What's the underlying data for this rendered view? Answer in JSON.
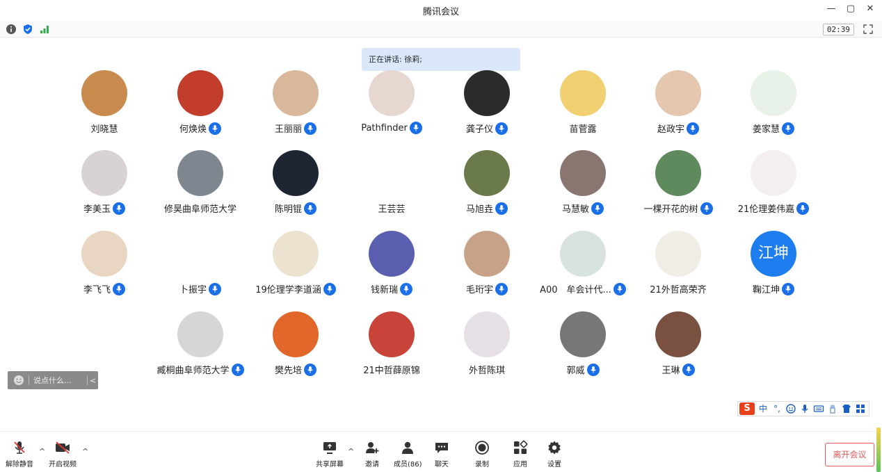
{
  "window": {
    "title": "腾讯会议",
    "minimize": "—",
    "restore": "▢",
    "close": "✕"
  },
  "meeting": {
    "timer": "02:39",
    "speaking": "正在讲话: 徐莉;"
  },
  "participants": [
    {
      "name": "刘晓慧",
      "mic": false,
      "bg": "#c98a4d"
    },
    {
      "name": "何焕焕",
      "mic": true,
      "bg": "#c23d2c"
    },
    {
      "name": "王丽丽",
      "mic": true,
      "bg": "#d9b79a"
    },
    {
      "name": "Pathfinder",
      "mic": true,
      "bg": "#e6d7d0"
    },
    {
      "name": "龚子仪",
      "mic": true,
      "bg": "#2b2b2b"
    },
    {
      "name": "苗菅露",
      "mic": false,
      "bg": "#f0d070"
    },
    {
      "name": "赵政宇",
      "mic": true,
      "bg": "#e5c7b0"
    },
    {
      "name": "姜家慧",
      "mic": true,
      "bg": "#e8f2e8"
    },
    {
      "name": "李美玉",
      "mic": true,
      "bg": "#d8d2d2"
    },
    {
      "name": "修昊曲阜师范大学",
      "mic": false,
      "bg": "#7e8790"
    },
    {
      "name": "陈明锟",
      "mic": true,
      "bg": "#1e2634"
    },
    {
      "name": "王芸芸",
      "mic": false,
      "bg": "#ffffff"
    },
    {
      "name": "马旭垚",
      "mic": true,
      "bg": "#6a7a4a"
    },
    {
      "name": "马慧敏",
      "mic": true,
      "bg": "#8a7670"
    },
    {
      "name": "一棵开花的树",
      "mic": true,
      "bg": "#5e8a5e"
    },
    {
      "name": "21伦理姜伟嘉",
      "mic": true,
      "bg": "#f2efee"
    },
    {
      "name": "李飞飞",
      "mic": true,
      "bg": "#e8d6c2"
    },
    {
      "name": "卜振宇",
      "mic": true,
      "bg": "#ffffff"
    },
    {
      "name": "19伦理学李道涵",
      "mic": true,
      "bg": "#ece2d0"
    },
    {
      "name": "钱新瑞",
      "mic": true,
      "bg": "#5a5fb0"
    },
    {
      "name": "毛珩宇",
      "mic": true,
      "bg": "#c8a288"
    },
    {
      "name": "A00　牟会计代...",
      "mic": true,
      "bg": "#d8e2de"
    },
    {
      "name": "21外哲高荣齐",
      "mic": false,
      "bg": "#f1ece4"
    },
    {
      "name": "鞠江坤",
      "mic": true,
      "text": "江坤",
      "bg": "#1e7ef0"
    },
    {
      "name": "臧桐曲阜师范大学",
      "mic": true,
      "bg": "#d6d6d6"
    },
    {
      "name": "樊先培",
      "mic": true,
      "bg": "#e0662a"
    },
    {
      "name": "21中哲薛原锦",
      "mic": false,
      "bg": "#c8443a"
    },
    {
      "name": "外哲陈琪",
      "mic": false,
      "bg": "#e6e0e6"
    },
    {
      "name": "郭威",
      "mic": true,
      "bg": "#777777"
    },
    {
      "name": "王琳",
      "mic": true,
      "bg": "#7a5040"
    }
  ],
  "chat": {
    "placeholder": "说点什么...",
    "arrow": "<"
  },
  "ime": {
    "logo": "S",
    "lang": "中",
    "punct": "°,"
  },
  "toolbar": {
    "unmute": "解除静音",
    "video": "开启视频",
    "share": "共享屏幕",
    "invite": "邀请",
    "members": "成员(86)",
    "chat": "聊天",
    "record": "录制",
    "apps": "应用",
    "settings": "设置",
    "leave": "离开会议",
    "caret": "^"
  }
}
